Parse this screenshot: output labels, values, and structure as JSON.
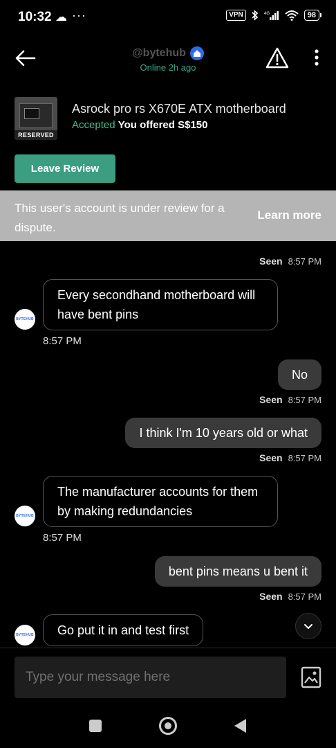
{
  "status_bar": {
    "time": "10:32",
    "cloud_icon": "cloud-icon",
    "dots": "···",
    "vpn": "VPN",
    "battery": "98"
  },
  "header": {
    "username": "@bytehub",
    "online_status": "Online 2h ago"
  },
  "listing": {
    "title": "Asrock pro rs X670E ATX motherboard",
    "status": "Accepted",
    "offer": "You offered S$150",
    "tag": "RESERVED"
  },
  "actions": {
    "leave_review": "Leave Review"
  },
  "banner": {
    "text": "This user's account is under review for a dispute.",
    "link": "Learn more"
  },
  "chat": {
    "seen_label": "Seen",
    "avatar_text": "BYTEHUB",
    "messages": [
      {
        "side": "meta",
        "seen": "Seen",
        "time": "8:57 PM"
      },
      {
        "side": "in",
        "text": "Every secondhand motherboard will have bent pins",
        "time": "8:57 PM"
      },
      {
        "side": "out",
        "text": "No",
        "seen": "Seen",
        "time": "8:57 PM"
      },
      {
        "side": "out",
        "text": "I think I'm 10 years old or what",
        "seen": "Seen",
        "time": "8:57 PM"
      },
      {
        "side": "in",
        "text": "The manufacturer accounts for them by making redundancies",
        "time": "8:57 PM"
      },
      {
        "side": "out",
        "text": "bent pins means u bent it",
        "seen": "Seen",
        "time": "8:57 PM"
      },
      {
        "side": "in",
        "text": "Go put it in and test first"
      }
    ]
  },
  "composer": {
    "placeholder": "Type your message here"
  },
  "colors": {
    "accent": "#3b9e80",
    "accepted": "#3fbf8f",
    "banner": "#b5b5b5",
    "verified": "#2f6be6"
  }
}
